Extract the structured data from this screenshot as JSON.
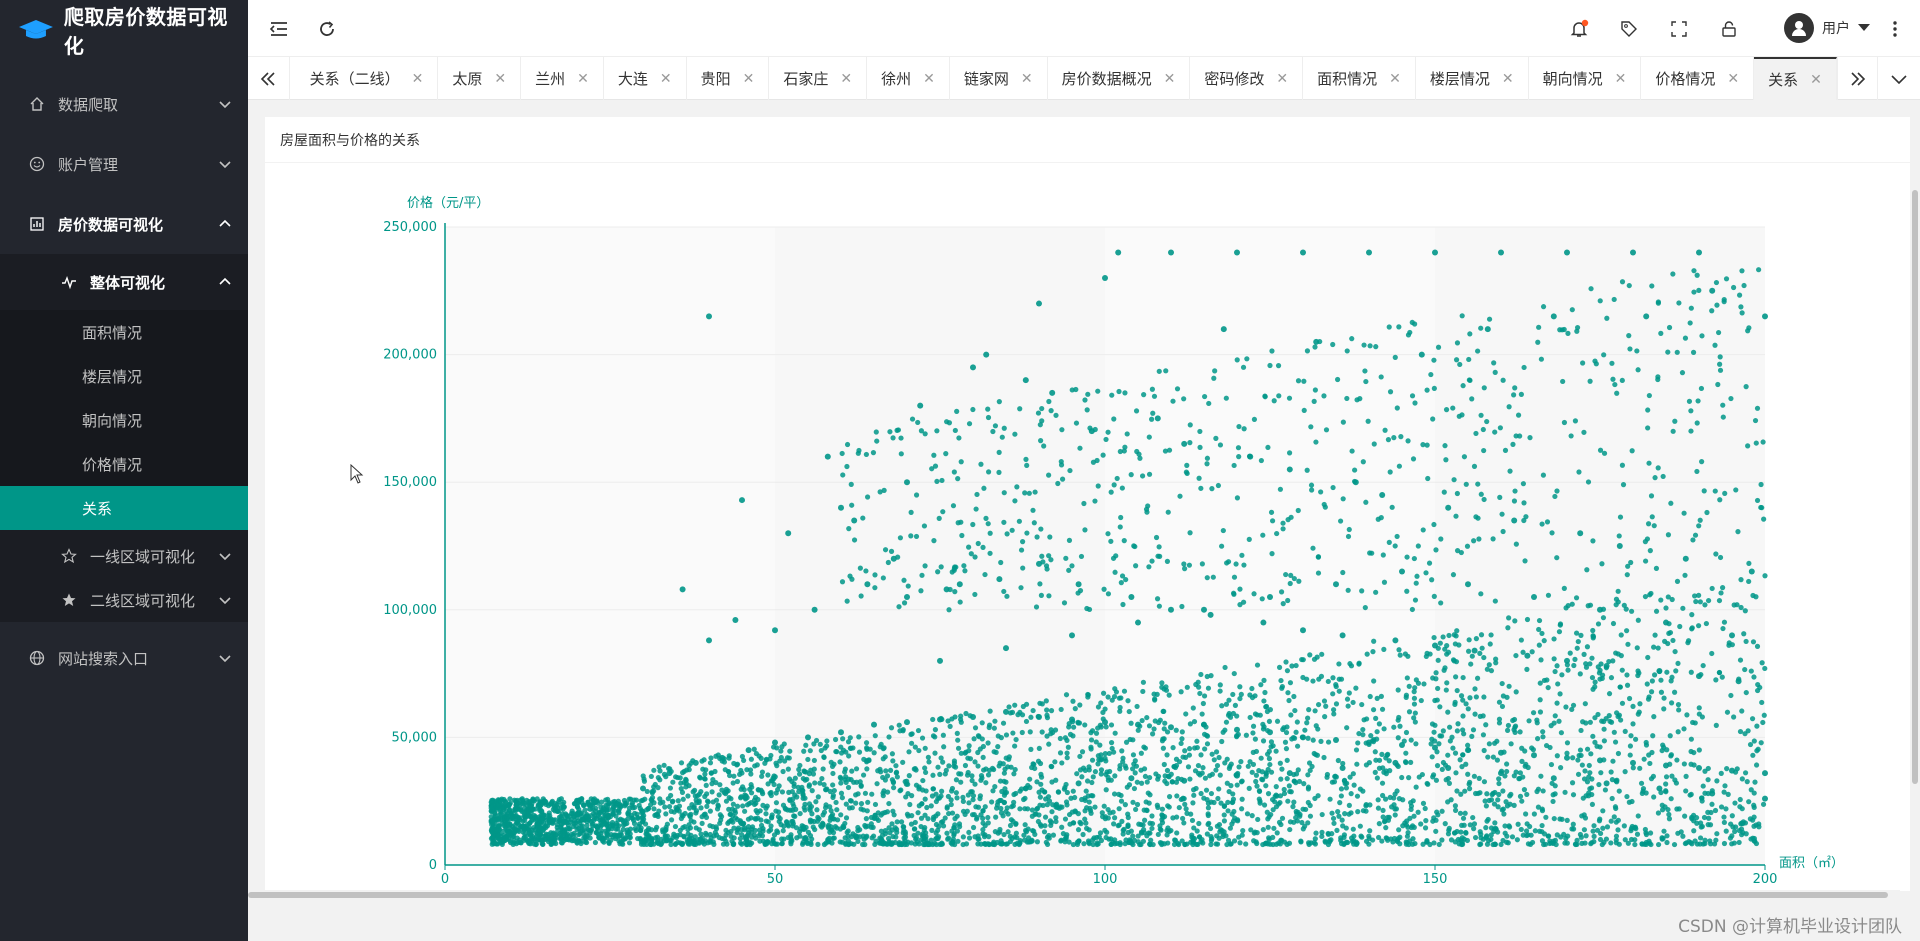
{
  "app": {
    "title": "爬取房价数据可视化"
  },
  "sidebar": {
    "items": [
      {
        "label": "数据爬取",
        "icon": "home-icon"
      },
      {
        "label": "账户管理",
        "icon": "smile-icon"
      },
      {
        "label": "房价数据可视化",
        "icon": "chart-icon"
      },
      {
        "label": "网站搜索入口",
        "icon": "globe-icon"
      }
    ],
    "viz_sub": {
      "overall": {
        "label": "整体可视化",
        "icon": "pulse-icon"
      },
      "overall_items": [
        "面积情况",
        "楼层情况",
        "朝向情况",
        "价格情况",
        "关系"
      ],
      "tier1": {
        "label": "一线区域可视化",
        "icon": "star-outline-icon"
      },
      "tier2": {
        "label": "二线区域可视化",
        "icon": "star-filled-icon"
      }
    }
  },
  "header": {
    "user_label": "用户",
    "notification_dot_color": "#ff5722"
  },
  "tabs": [
    {
      "label": "关系（二线）"
    },
    {
      "label": "太原"
    },
    {
      "label": "兰州"
    },
    {
      "label": "大连"
    },
    {
      "label": "贵阳"
    },
    {
      "label": "石家庄"
    },
    {
      "label": "徐州"
    },
    {
      "label": "链家网"
    },
    {
      "label": "房价数据概况"
    },
    {
      "label": "密码修改"
    },
    {
      "label": "面积情况"
    },
    {
      "label": "楼层情况"
    },
    {
      "label": "朝向情况"
    },
    {
      "label": "价格情况"
    },
    {
      "label": "关系",
      "active": true
    }
  ],
  "content": {
    "card_title": "房屋面积与价格的关系"
  },
  "chart_data": {
    "type": "scatter",
    "xlabel": "面积（㎡）",
    "ylabel": "价格（元/平）",
    "xlim": [
      0,
      200
    ],
    "ylim": [
      0,
      250000
    ],
    "y_ticks": [
      "250,000",
      "200,000",
      "150,000",
      "100,000",
      "50,000",
      "0"
    ],
    "x_ticks": [
      "0",
      "50",
      "100",
      "150",
      "200"
    ],
    "point_color": "#009688",
    "grid": true,
    "series": [
      {
        "x": [
          8,
          10,
          12,
          14,
          16,
          18,
          20,
          22,
          24,
          26,
          30,
          34,
          38,
          42,
          46,
          50,
          55,
          60,
          65,
          70,
          75,
          80,
          85,
          90,
          95,
          100,
          105,
          110,
          115,
          120,
          125,
          130,
          135,
          140,
          145,
          150,
          155,
          160,
          165,
          170,
          175,
          180,
          185,
          190,
          195,
          200,
          40,
          45,
          52,
          58,
          62,
          68,
          72,
          78,
          82,
          88,
          92,
          98,
          102,
          108,
          112,
          118,
          122,
          128,
          132,
          138,
          142,
          148,
          152,
          158,
          162,
          168,
          172,
          178,
          182,
          188,
          192,
          198,
          36,
          44,
          50,
          56,
          64,
          70,
          76,
          84,
          90,
          96,
          104,
          110,
          116,
          124,
          130,
          136,
          144,
          150,
          156,
          164,
          170,
          176,
          184,
          190,
          196,
          40,
          60,
          70,
          80,
          90,
          100,
          110,
          120,
          130,
          140,
          150,
          160,
          170,
          180,
          190,
          200,
          75,
          85,
          95,
          105,
          115,
          125,
          135,
          145,
          155,
          165,
          175,
          185,
          195,
          88,
          96,
          104,
          112,
          120,
          128,
          136,
          144,
          152,
          160,
          168,
          176,
          184,
          192,
          200
        ],
        "y": [
          12000,
          14000,
          15000,
          16000,
          18000,
          17000,
          20000,
          22000,
          21000,
          24000,
          30000,
          36000,
          40000,
          42000,
          45000,
          48000,
          50000,
          52000,
          55000,
          56000,
          57000,
          58000,
          60000,
          58000,
          57000,
          56000,
          55000,
          54000,
          55000,
          53000,
          52000,
          50000,
          49000,
          48000,
          47000,
          46000,
          45000,
          44000,
          43000,
          42000,
          41000,
          40000,
          39000,
          38000,
          37000,
          36000,
          215000,
          143000,
          130000,
          160000,
          135000,
          120000,
          180000,
          110000,
          200000,
          190000,
          185000,
          170000,
          240000,
          175000,
          165000,
          210000,
          160000,
          155000,
          205000,
          150000,
          145000,
          200000,
          140000,
          210000,
          135000,
          215000,
          130000,
          125000,
          215000,
          120000,
          225000,
          115000,
          108000,
          96000,
          92000,
          100000,
          110000,
          105000,
          108000,
          112000,
          118000,
          110000,
          105000,
          100000,
          98000,
          95000,
          92000,
          90000,
          88000,
          86000,
          84000,
          82000,
          80000,
          78000,
          76000,
          74000,
          72000,
          88000,
          140000,
          150000,
          195000,
          220000,
          230000,
          240000,
          240000,
          240000,
          240000,
          240000,
          240000,
          240000,
          240000,
          240000,
          215000,
          80000,
          85000,
          90000,
          95000,
          100000,
          105000,
          110000,
          115000,
          110000,
          105000,
          100000,
          95000,
          90000,
          30000,
          32000,
          34000,
          33000,
          35000,
          36000,
          38000,
          40000,
          38000,
          36000,
          34000,
          32000,
          30000,
          28000,
          26000
        ]
      }
    ]
  }
}
